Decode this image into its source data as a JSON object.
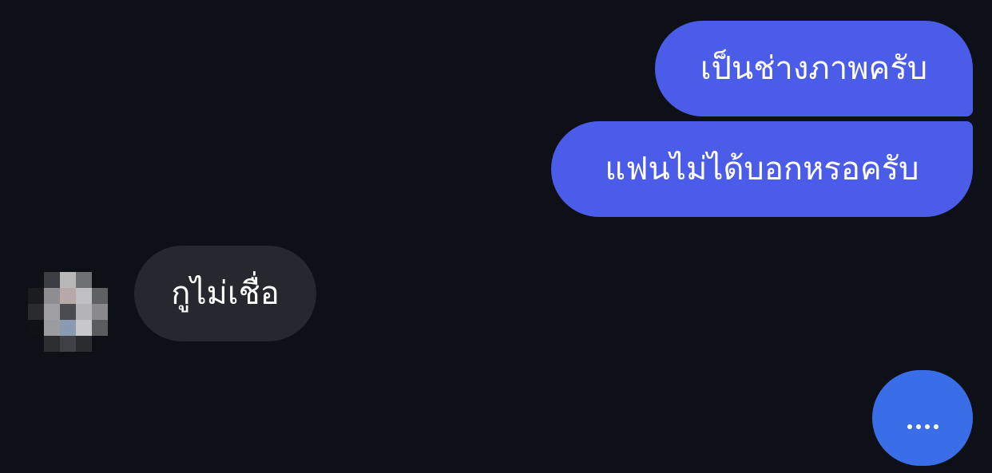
{
  "messages": {
    "outgoing": [
      {
        "text": "เป็นช่างภาพครับ"
      },
      {
        "text": "แฟนไม่ได้บอกหรอครับ"
      }
    ],
    "incoming": [
      {
        "text": "กูไม่เชื่อ"
      }
    ]
  },
  "colors": {
    "background": "#0d1016",
    "outgoing_bubble": "#4a5ce8",
    "incoming_bubble": "#25282e",
    "typing_bubble": "#3a6ee8"
  },
  "icons": {
    "avatar": "pixelated-avatar-icon",
    "typing": "typing-dots-icon"
  }
}
